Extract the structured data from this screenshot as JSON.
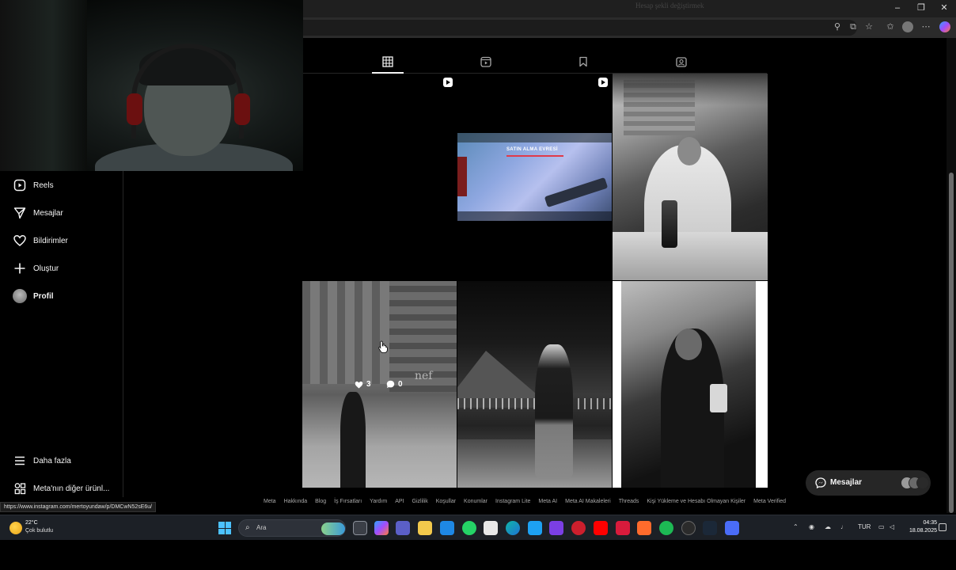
{
  "browser": {
    "page_title": "Hesap şekli değiştirmek",
    "minimize_label": "–",
    "restore_label": "❐",
    "close_label": "✕"
  },
  "sidebar": {
    "items": [
      {
        "label": "Reels",
        "icon": "reels-icon"
      },
      {
        "label": "Mesajlar",
        "icon": "paper-plane-icon"
      },
      {
        "label": "Bildirimler",
        "icon": "heart-icon"
      },
      {
        "label": "Oluştur",
        "icon": "plus-icon"
      },
      {
        "label": "Profil",
        "icon": "profile-avatar"
      }
    ],
    "more_label": "Daha fazla",
    "meta_label": "Meta'nın diğer ürünl..."
  },
  "profile_tabs": [
    {
      "name": "posts-grid",
      "icon": "grid-icon",
      "active": true
    },
    {
      "name": "reels",
      "icon": "reels-tab-icon",
      "active": false
    },
    {
      "name": "saved",
      "icon": "bookmark-icon",
      "active": false
    },
    {
      "name": "tagged",
      "icon": "tagged-icon",
      "active": false
    }
  ],
  "posts": {
    "game_banner": "SATIN ALMA EVRESİ",
    "street_logo": "nef",
    "hover_likes": "3",
    "hover_comments": "0"
  },
  "footer": {
    "links": [
      "Meta",
      "Hakkında",
      "Blog",
      "İş Fırsatları",
      "Yardım",
      "API",
      "Gizlilik",
      "Koşullar",
      "Konumlar",
      "Instagram Lite",
      "Meta AI",
      "Meta AI Makaleleri",
      "Threads",
      "Kişi Yükleme ve Hesabı Olmayan Kişiler",
      "Meta Verified"
    ]
  },
  "status_url": "https://www.instagram.com/mertoyundaw/p/DMCwN52sE6u/",
  "messages_pill": {
    "label": "Mesajlar"
  },
  "taskbar": {
    "weather_temp": "22°C",
    "weather_desc": "Çok bulutlu",
    "search_label": "Ara",
    "language": "TUR",
    "time": "04:35",
    "date": "18.08.2025"
  },
  "colors": {
    "background": "#000000",
    "text": "#f5f5f5",
    "muted": "#a8a8a8",
    "taskbar": "#1c2026",
    "windows_accent": "#4cc2ff"
  }
}
